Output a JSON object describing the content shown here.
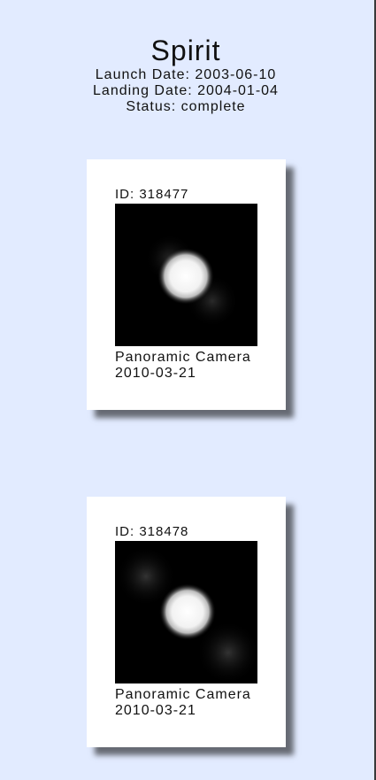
{
  "rover": {
    "name": "Spirit",
    "launch_date": "Launch Date: 2003-06-10",
    "landing_date": "Landing Date: 2004-01-04",
    "status": "Status: complete"
  },
  "photos": [
    {
      "id": "ID: 318477",
      "camera": "Panoramic Camera",
      "earth_date": "2010-03-21"
    },
    {
      "id": "ID: 318478",
      "camera": "Panoramic Camera",
      "earth_date": "2010-03-21"
    }
  ]
}
